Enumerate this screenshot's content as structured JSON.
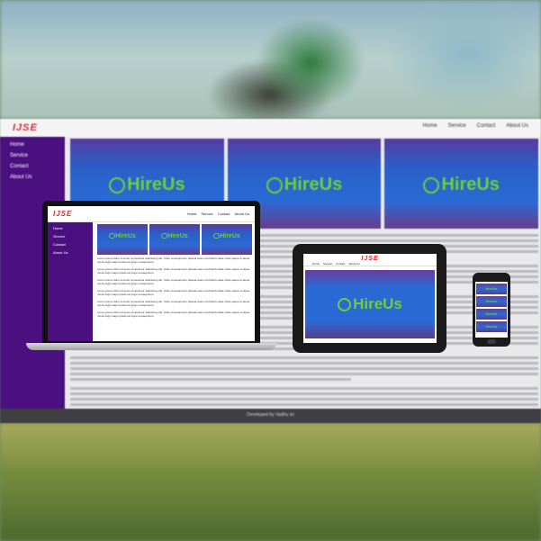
{
  "logo": "IJSE",
  "nav": [
    "Home",
    "Service",
    "Contact",
    "About Us"
  ],
  "sidebar": [
    "Home",
    "Service",
    "Contact",
    "About Us"
  ],
  "banner_brand": "HireUs",
  "footer": "Developed by Vadhu sri",
  "colors": {
    "accent_purple": "#4a1080",
    "logo_red": "#e0262d",
    "brand_green": "#6ccf3a",
    "banner_blue": "#2a6ad4"
  },
  "paragraph": "Lorem ipsum dolor sit amet consectetur adipisicing elit. Unde consequuntur placeat autem architecto alias nobis eaque et atque minus fugit magni possimus fuga consequuntur."
}
